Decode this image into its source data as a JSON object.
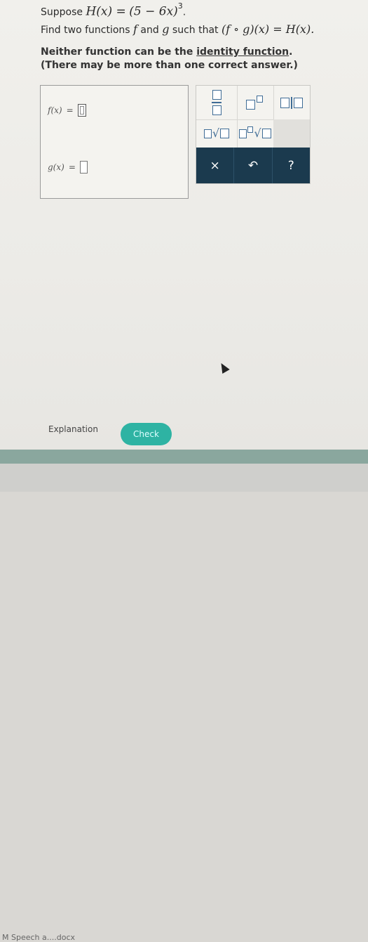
{
  "question": {
    "suppose_word": "Suppose",
    "function_def_lhs": "H(x) =",
    "function_def_rhs": "(5 − 6x)",
    "exponent": "3",
    "end_period": ".",
    "find_text": "Find two functions",
    "find_f": "f",
    "find_and": "and",
    "find_g": "g",
    "find_such": "such that",
    "composition": "(f ∘ g)(x) = H(x).",
    "note_line1_prefix": "Neither function can be the ",
    "note_line1_link": "identity function",
    "note_line1_suffix": ".",
    "note_line2": "(There may be more than one correct answer.)"
  },
  "answer": {
    "f_label": "f(x)",
    "g_label": "g(x)",
    "equals": "="
  },
  "palette": {
    "actions": {
      "clear_symbol": "×",
      "undo_symbol": "↶",
      "help_symbol": "?"
    }
  },
  "footer": {
    "explanation_label": "Explanation",
    "check_label": "Check",
    "download_label": "M Speech a....docx"
  }
}
